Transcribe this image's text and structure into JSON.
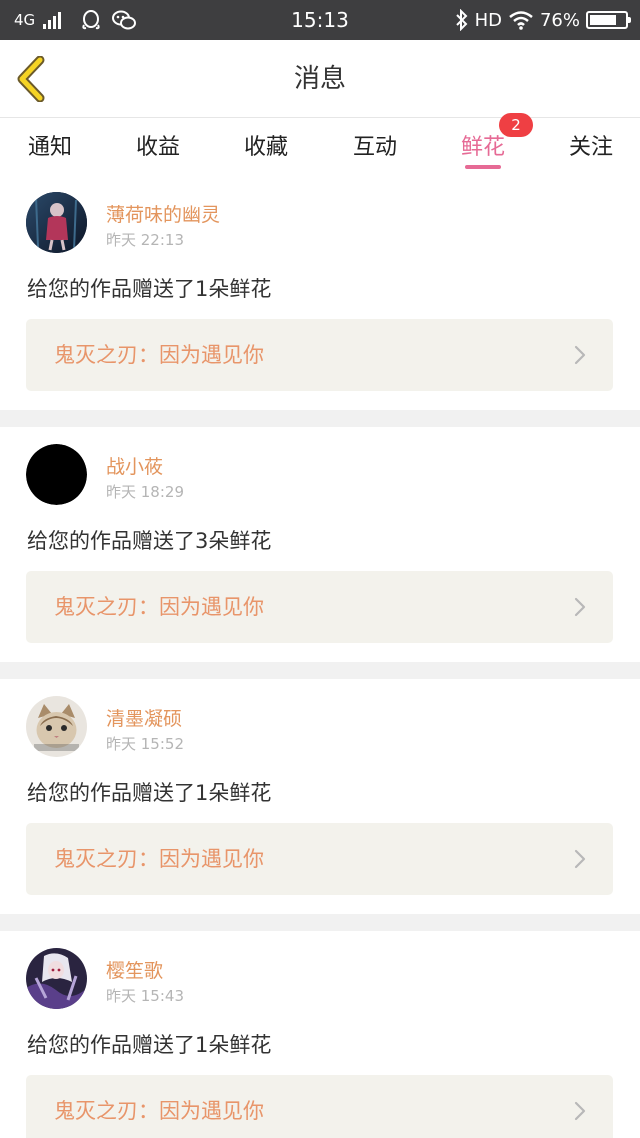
{
  "status_bar": {
    "network": "4G",
    "time": "15:13",
    "bluetooth_icon": "bluetooth-icon",
    "hd": "HD",
    "wifi_icon": "wifi-icon",
    "battery": "76%",
    "battery_level": 0.76
  },
  "header": {
    "back_icon": "chevron-left-icon",
    "title": "消息"
  },
  "tabs": [
    {
      "label": "通知"
    },
    {
      "label": "收益"
    },
    {
      "label": "收藏"
    },
    {
      "label": "互动"
    },
    {
      "label": "鲜花",
      "badge": "2",
      "active": true
    },
    {
      "label": "关注"
    }
  ],
  "messages": [
    {
      "user": "薄荷味的幽灵",
      "time": "昨天 22:13",
      "text": "给您的作品赠送了1朵鲜花",
      "work": "鬼灭之刃：因为遇见你"
    },
    {
      "user": "战小莜",
      "time": "昨天 18:29",
      "text": "给您的作品赠送了3朵鲜花",
      "work": "鬼灭之刃：因为遇见你"
    },
    {
      "user": "清墨凝硕",
      "time": "昨天 15:52",
      "text": "给您的作品赠送了1朵鲜花",
      "work": "鬼灭之刃：因为遇见你"
    },
    {
      "user": "樱笙歌",
      "time": "昨天 15:43",
      "text": "给您的作品赠送了1朵鲜花",
      "work": "鬼灭之刃：因为遇见你"
    }
  ],
  "colors": {
    "accent_pink": "#e66a95",
    "username_orange": "#e3955d",
    "work_title_orange": "#e8956a",
    "badge_red": "#ef3f43",
    "back_yellow": "#f5d324"
  }
}
